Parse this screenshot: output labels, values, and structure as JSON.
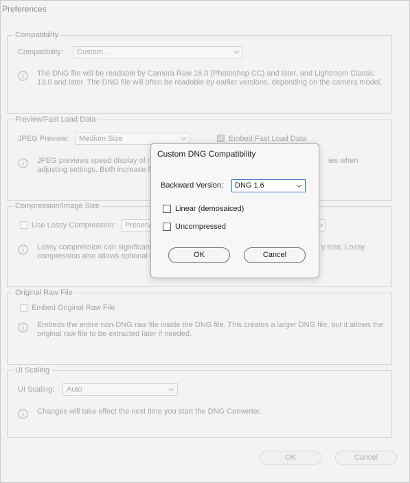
{
  "window": {
    "title": "Preferences"
  },
  "compatibility": {
    "legend": "Compatibility",
    "label": "Compatibility:",
    "value": "Custom...",
    "info": [
      "The DNG file will be readable by Camera Raw 16.0 (Photoshop CC) and later, and Lightroom Classic",
      "13.0 and later. The DNG file will often be readable by earlier versions, depending on the camera model."
    ]
  },
  "preview": {
    "legend": "Preview/Fast Load Data",
    "jpeg_label": "JPEG Preview:",
    "jpeg_value": "Medium Size",
    "embed_label": "Embed Fast Load Data",
    "info": [
      "JPEG previews speed display of re",
      "ies when",
      "adjusting settings.  Both increase f"
    ]
  },
  "compression": {
    "legend": "Compression/Image Size",
    "lossy_label": "Use Lossy Compression:",
    "lossy_value": "Preserve",
    "info": [
      "Lossy compression can significantly",
      "y loss.  Lossy",
      "compression also allows optional re"
    ]
  },
  "original": {
    "legend": "Original Raw File",
    "embed_label": "Embed Original Raw File",
    "info": [
      "Embeds the entire non-DNG raw file inside the DNG file.  This creates a larger DNG file, but it allows the",
      "original raw file to be extracted later if needed."
    ]
  },
  "ui_scaling": {
    "legend": "UI Scaling",
    "label": "UI Scaling:",
    "value": "Auto",
    "info": "Changes will take effect the next time you start the DNG Converter."
  },
  "footer": {
    "ok": "OK",
    "cancel": "Cancel"
  },
  "dialog": {
    "title": "Custom DNG Compatibility",
    "backward_label": "Backward Version:",
    "backward_value": "DNG 1.6",
    "linear_label": "Linear (demosaiced)",
    "uncompressed_label": "Uncompressed",
    "ok": "OK",
    "cancel": "Cancel"
  },
  "icons": {
    "info": "info-circle-icon",
    "chevron": "chevron-down-icon",
    "check": "checkmark-icon"
  },
  "colors": {
    "accent": "#2f6fc6",
    "disabled_text": "#a8a8a8",
    "background": "#f3f3f3"
  }
}
